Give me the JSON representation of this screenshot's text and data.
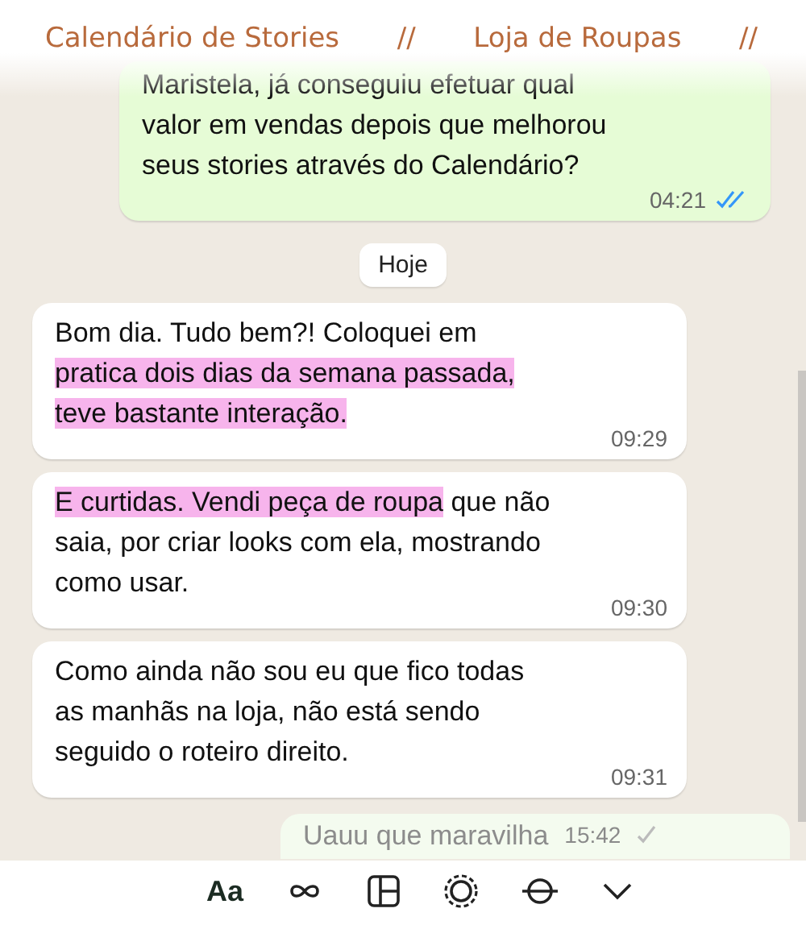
{
  "header": {
    "items": [
      "Calendário de Stories",
      "//",
      "Loja de Roupas",
      "//"
    ]
  },
  "messages": [
    {
      "kind": "outgoing",
      "lines": [
        [
          {
            "text": "Maristela, já conseguiu efetuar qual",
            "highlighted": false
          }
        ],
        [
          {
            "text": "valor em vendas depois que melhorou",
            "highlighted": false
          }
        ],
        [
          {
            "text": "seus stories através do Calendário?",
            "highlighted": false
          }
        ]
      ],
      "time": "04:21",
      "read": true
    },
    {
      "kind": "date",
      "label": "Hoje"
    },
    {
      "kind": "incoming",
      "lines": [
        [
          {
            "text": "Bom dia. Tudo bem?!  Coloquei em",
            "highlighted": false
          }
        ],
        [
          {
            "text": "pratica dois dias da semana passada,",
            "highlighted": true
          }
        ],
        [
          {
            "text": "teve bastante interação.",
            "highlighted": true
          }
        ]
      ],
      "time": "09:29"
    },
    {
      "kind": "incoming",
      "lines": [
        [
          {
            "text": "E curtidas. Vendi peça de roupa",
            "highlighted": true
          },
          {
            "text": " que não",
            "highlighted": false
          }
        ],
        [
          {
            "text": "saia, por criar looks com ela, mostrando",
            "highlighted": false
          }
        ],
        [
          {
            "text": "como usar.",
            "highlighted": false
          }
        ]
      ],
      "time": "09:30"
    },
    {
      "kind": "incoming",
      "lines": [
        [
          {
            "text": "Como ainda não sou eu que fico todas",
            "highlighted": false
          }
        ],
        [
          {
            "text": "as manhãs na loja, não está sendo",
            "highlighted": false
          }
        ],
        [
          {
            "text": "seguido o roteiro direito.",
            "highlighted": false
          }
        ]
      ],
      "time": "09:31"
    },
    {
      "kind": "outgoing-faded",
      "lines": [
        [
          {
            "text": "Uauu que maravilha",
            "highlighted": false
          }
        ]
      ],
      "time": "15:42",
      "read": false
    }
  ],
  "toolbar": {
    "label": "Aa"
  }
}
